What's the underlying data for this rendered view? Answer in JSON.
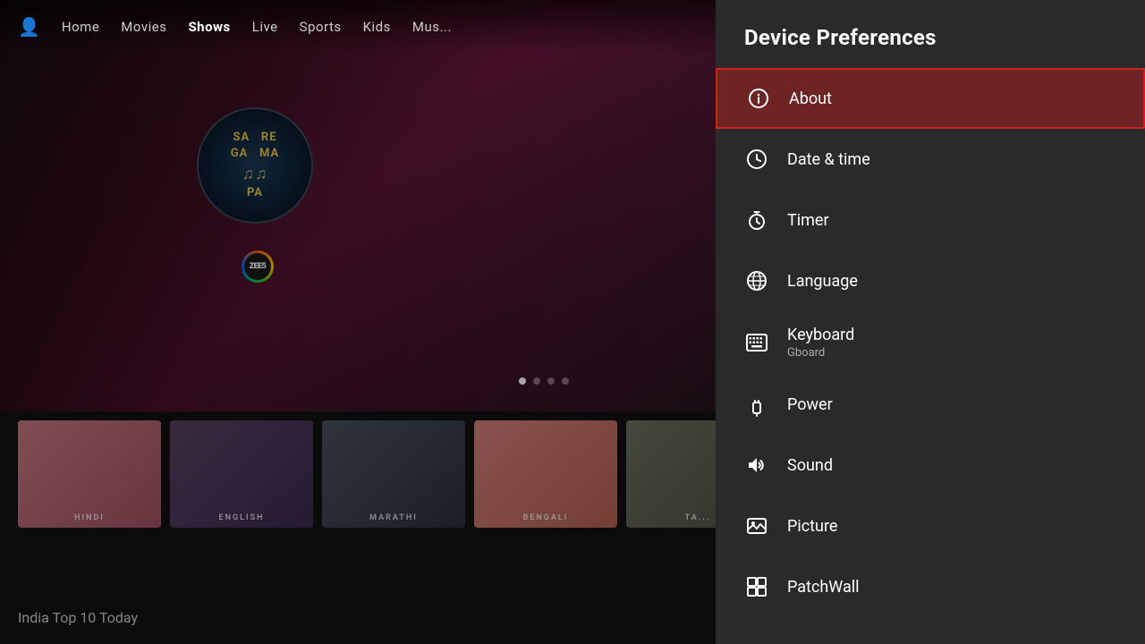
{
  "navbar": {
    "items": [
      {
        "label": "Home",
        "active": false
      },
      {
        "label": "Movies",
        "active": false
      },
      {
        "label": "Shows",
        "active": true
      },
      {
        "label": "Live",
        "active": false
      },
      {
        "label": "Sports",
        "active": false
      },
      {
        "label": "Kids",
        "active": false
      },
      {
        "label": "Mus...",
        "active": false
      }
    ]
  },
  "hero": {
    "logo_lines": [
      "SA  RE",
      "GA  MA",
      "PA"
    ],
    "badge": "ZEE5",
    "dots": [
      true,
      false,
      false,
      false
    ]
  },
  "thumbnails": {
    "section_label": "India Top 10 Today",
    "items": [
      {
        "label": "HINDI"
      },
      {
        "label": "ENGLISH"
      },
      {
        "label": "MARATHI"
      },
      {
        "label": "BENGALI"
      },
      {
        "label": "TA..."
      }
    ]
  },
  "settings": {
    "title": "Device Preferences",
    "items": [
      {
        "id": "about",
        "label": "About",
        "sublabel": "",
        "icon": "info-circle",
        "selected": true
      },
      {
        "id": "date-time",
        "label": "Date & time",
        "sublabel": "",
        "icon": "clock",
        "selected": false
      },
      {
        "id": "timer",
        "label": "Timer",
        "sublabel": "",
        "icon": "stopwatch",
        "selected": false
      },
      {
        "id": "language",
        "label": "Language",
        "sublabel": "",
        "icon": "globe",
        "selected": false
      },
      {
        "id": "keyboard",
        "label": "Keyboard",
        "sublabel": "Gboard",
        "icon": "keyboard",
        "selected": false
      },
      {
        "id": "power",
        "label": "Power",
        "sublabel": "",
        "icon": "plug",
        "selected": false
      },
      {
        "id": "sound",
        "label": "Sound",
        "sublabel": "",
        "icon": "volume",
        "selected": false
      },
      {
        "id": "picture",
        "label": "Picture",
        "sublabel": "",
        "icon": "picture",
        "selected": false
      },
      {
        "id": "patchwall",
        "label": "PatchWall",
        "sublabel": "",
        "icon": "patchwall",
        "selected": false
      }
    ]
  }
}
